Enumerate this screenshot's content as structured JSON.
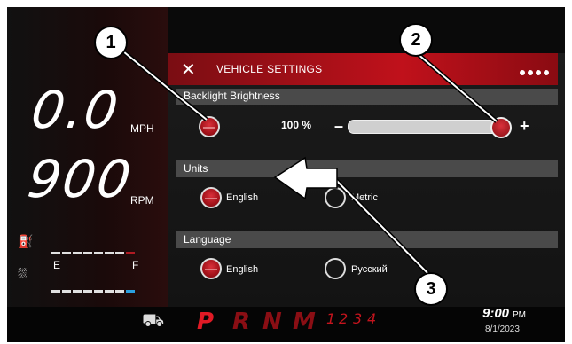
{
  "left_panel": {
    "speed_value": "0.0",
    "speed_unit": "MPH",
    "rpm_value": "900",
    "rpm_unit": "RPM",
    "fuel_icon": "fuel-pump-icon",
    "oil_icon": "oil-level-icon",
    "empty_label": "E",
    "full_label": "F"
  },
  "header": {
    "title": "VEHICLE SETTINGS",
    "icon": "tools-icon",
    "dot_colors": [
      "#ffffff",
      "#8a8a8a",
      "#8a8a8a",
      "#8a8a8a"
    ]
  },
  "sections": {
    "brightness": {
      "label": "Backlight Brightness",
      "value": "100 %",
      "minus": "–",
      "plus": "+",
      "level": 1.0
    },
    "units": {
      "label": "Units",
      "options": [
        "English",
        "Metric"
      ],
      "selected": "English"
    },
    "language": {
      "label": "Language",
      "options": [
        "English",
        "Русский"
      ],
      "selected": "English"
    }
  },
  "bottom_bar": {
    "gears": [
      "P",
      "R",
      "N",
      "M"
    ],
    "gear_numbers": [
      "1",
      "2",
      "3",
      "4"
    ],
    "time": "9:00",
    "ampm": "PM",
    "date": "8/1/2023",
    "vehicle_icon": "vehicle-icon"
  },
  "callouts": [
    "1",
    "2",
    "3"
  ],
  "colors": {
    "accent_red": "#c0111b",
    "active_gear": "#c4141d",
    "panel_bg": "#0a0a0a"
  }
}
